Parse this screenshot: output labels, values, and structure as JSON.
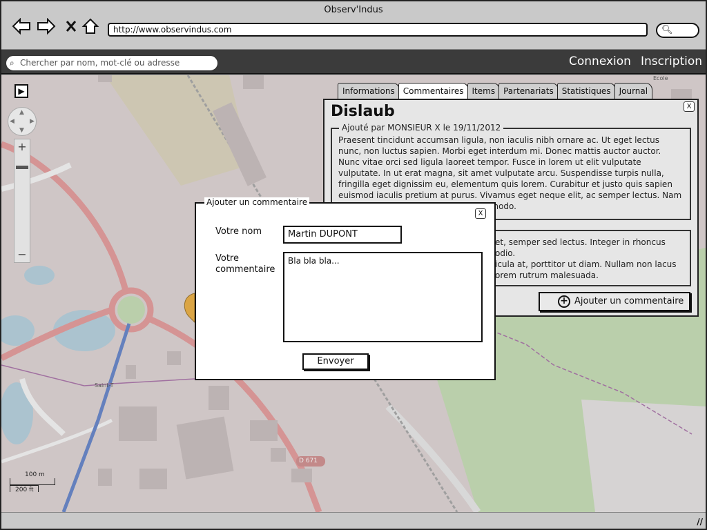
{
  "browser": {
    "window_title": "Observ'Indus",
    "url": "http://www.observindus.com"
  },
  "header": {
    "search_placeholder": "Chercher par nom, mot-clé ou adresse",
    "login_label": "Connexion",
    "signup_label": "Inscription"
  },
  "map": {
    "labels": {
      "ecole": "Ecole",
      "saint": "Saint-T",
      "road": "D 671"
    },
    "scale": {
      "metric": "100 m",
      "imperial": "200 ft"
    },
    "zoom_in": "+",
    "zoom_out": "−"
  },
  "panel": {
    "tabs": [
      {
        "label": "Informations"
      },
      {
        "label": "Commentaires"
      },
      {
        "label": "Items"
      },
      {
        "label": "Partenariats"
      },
      {
        "label": "Statistiques"
      },
      {
        "label": "Journal"
      }
    ],
    "active_tab": "Commentaires",
    "title": "Dislaub",
    "close_label": "X",
    "comments": [
      {
        "header": "Ajouté par MONSIEUR X le 19/11/2012",
        "text": "Praesent tincidunt accumsan ligula, non iaculis nibh ornare ac. Ut eget lectus nunc, non luctus sapien. Morbi eget interdum mi. Donec mattis auctor auctor. Nunc vitae orci sed ligula laoreet tempor. Fusce in lorem ut elit vulputate vulputate. In ut erat magna, sit amet vulputate arcu. Suspendisse turpis nulla, fringilla eget dignissim eu, elementum quis lorem. Curabitur et justo quis sapien euismod iaculis pretium at purus. Vivamus eget neque elit, ac semper lectus. Nam rutrum lorem ac arcu commodo commodo."
      },
      {
        "header": "",
        "text_lines": [
          "et, semper sed lectus. Integer in rhoncus odio.",
          "icula at, porttitor ut diam. Nullam non lacus",
          "orem rutrum malesuada."
        ]
      }
    ],
    "add_comment_label": "Ajouter un commentaire"
  },
  "modal": {
    "legend": "Ajouter un commentaire",
    "close_label": "X",
    "name_label": "Votre nom",
    "name_value": "Martin DUPONT",
    "comment_label_line1": "Votre",
    "comment_label_line2": "commentaire",
    "comment_value": "Bla bla bla...",
    "send_label": "Envoyer"
  },
  "colors": {
    "app_header": "#3b3b3b",
    "map_road": "#e08a8a",
    "map_park": "#bcd9a8",
    "map_water": "#a9c9d9",
    "map_tram": "#4a6fc0"
  }
}
